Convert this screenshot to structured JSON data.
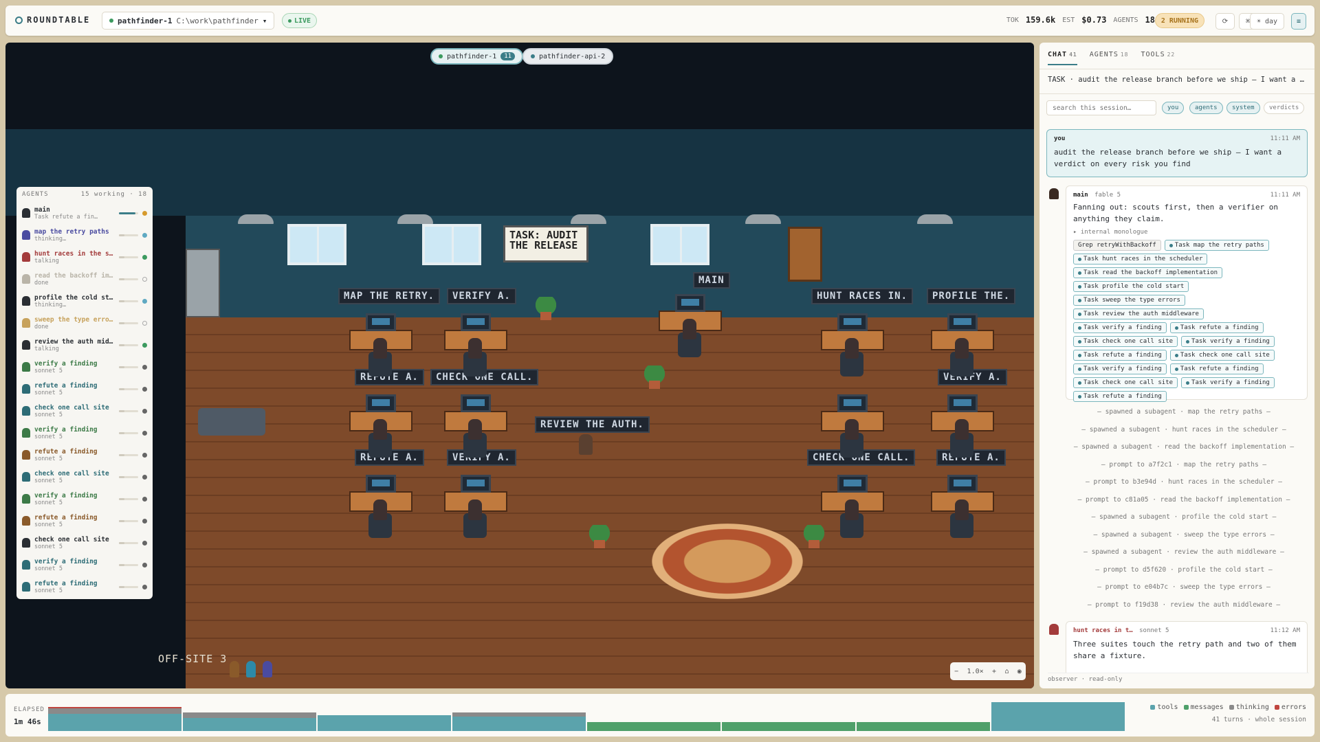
{
  "topbar": {
    "brand": "ROUNDTABLE",
    "repo_name": "pathfinder-1",
    "repo_path": "C:\\work\\pathfinder",
    "repo_caret": "▾",
    "live": "LIVE",
    "tok_label": "TOK",
    "tok_value": "159.6k",
    "est_label": "EST",
    "est_value": "$0.73",
    "agents_label": "AGENTS",
    "agents_value": "18",
    "running": "2 RUNNING",
    "refresh_icon": "⟳",
    "kbd_label": "⌘K",
    "help_label": "?",
    "theme_label": "☀ day",
    "menu_icon": "≡"
  },
  "projects": [
    {
      "label": "pathfinder-1",
      "badge": "11"
    },
    {
      "label": "pathfinder-api-2"
    }
  ],
  "scene": {
    "task_board": "TASK: AUDIT THE RELEASE",
    "room_label": "OFF-SITE 3",
    "signs": [
      "MAP THE RETRY.",
      "VERIFY A.",
      "MAIN",
      "HUNT RACES IN.",
      "PROFILE THE.",
      "REFUTE A.",
      "CHECK ONE CALL.",
      "VERIFY A.",
      "REVIEW THE AUTH.",
      "REFUTE A.",
      "VERIFY A.",
      "CHECK ONE CALL.",
      "REFUTE A."
    ]
  },
  "zoom": {
    "minus": "−",
    "value": "1.0×",
    "plus": "+",
    "home": "⌂",
    "target": "◉"
  },
  "agents_panel": {
    "title": "AGENTS",
    "summary": "15 working · 18",
    "items": [
      {
        "name": "main",
        "sub": "Task refute a fin…",
        "color": "#2a2e33",
        "status": "#d69a2d",
        "progress": 0.85
      },
      {
        "name": "map the retry paths",
        "sub": "thinking…",
        "color": "#4a4ba0",
        "status": "#5fa9c2",
        "progress": 0.3
      },
      {
        "name": "hunt races in the sch…",
        "sub": "talking",
        "color": "#a33b3b",
        "status": "#3c9a5f",
        "progress": 0.3
      },
      {
        "name": "read the backoff impl…",
        "sub": "done",
        "color": "#b9b4a8",
        "status": "none",
        "progress": 0.3
      },
      {
        "name": "profile the cold start",
        "sub": "thinking…",
        "color": "#2a2e33",
        "status": "#5fa9c2",
        "progress": 0.3
      },
      {
        "name": "sweep the type errors",
        "sub": "done",
        "color": "#c7a25c",
        "status": "none",
        "progress": 0.3
      },
      {
        "name": "review the auth middl…",
        "sub": "talking",
        "color": "#2a2e33",
        "status": "#3c9a5f",
        "progress": 0.3
      },
      {
        "name": "verify a finding",
        "sub": "sonnet 5",
        "color": "#3c7a47",
        "status": "#666",
        "progress": 0.3
      },
      {
        "name": "refute a finding",
        "sub": "sonnet 5",
        "color": "#2d6c76",
        "status": "#666",
        "progress": 0.3
      },
      {
        "name": "check one call site",
        "sub": "sonnet 5",
        "color": "#2d6c76",
        "status": "#666",
        "progress": 0.3
      },
      {
        "name": "verify a finding",
        "sub": "sonnet 5",
        "color": "#3c7a47",
        "status": "#666",
        "progress": 0.3
      },
      {
        "name": "refute a finding",
        "sub": "sonnet 5",
        "color": "#8a5a2a",
        "status": "#666",
        "progress": 0.3
      },
      {
        "name": "check one call site",
        "sub": "sonnet 5",
        "color": "#2d6c76",
        "status": "#666",
        "progress": 0.3
      },
      {
        "name": "verify a finding",
        "sub": "sonnet 5",
        "color": "#3c7a47",
        "status": "#666",
        "progress": 0.3
      },
      {
        "name": "refute a finding",
        "sub": "sonnet 5",
        "color": "#8a5a2a",
        "status": "#666",
        "progress": 0.3
      },
      {
        "name": "check one call site",
        "sub": "sonnet 5",
        "color": "#2a2e33",
        "status": "#666",
        "progress": 0.3
      },
      {
        "name": "verify a finding",
        "sub": "sonnet 5",
        "color": "#2d6c76",
        "status": "#666",
        "progress": 0.3
      },
      {
        "name": "refute a finding",
        "sub": "sonnet 5",
        "color": "#2d6c76",
        "status": "#666",
        "progress": 0.3
      }
    ]
  },
  "side": {
    "tabs": [
      {
        "label": "CHAT",
        "count": "41"
      },
      {
        "label": "AGENTS",
        "count": "18"
      },
      {
        "label": "TOOLS",
        "count": "22"
      }
    ],
    "task": "TASK · audit the release branch before we ship — I want a verdict on every risk you find",
    "search_placeholder": "search this session…",
    "filters": [
      "you",
      "agents",
      "system",
      "verdicts"
    ],
    "you_msg": {
      "author": "you",
      "time": "11:11 AM",
      "text": "audit the release branch before we ship — I want a verdict on every risk you find"
    },
    "main_msg": {
      "author": "main",
      "model": "fable 5",
      "time": "11:11 AM",
      "text": "Fanning out: scouts first, then a verifier on anything they claim.",
      "monologue": "▸ internal monologue",
      "chips": [
        "Grep retryWithBackoff",
        "Task map the retry paths",
        "Task hunt races in the scheduler",
        "Task read the backoff implementation",
        "Task profile the cold start",
        "Task sweep the type errors",
        "Task review the auth middleware",
        "Task verify a finding",
        "Task refute a finding",
        "Task check one call site",
        "Task verify a finding",
        "Task refute a finding",
        "Task check one call site",
        "Task verify a finding",
        "Task refute a finding",
        "Task check one call site",
        "Task verify a finding",
        "Task refute a finding"
      ]
    },
    "system_lines": [
      "— spawned a subagent · map the retry paths —",
      "— spawned a subagent · hunt races in the scheduler —",
      "— spawned a subagent · read the backoff implementation —",
      "— prompt to a7f2c1 · map the retry paths —",
      "— prompt to b3e94d · hunt races in the scheduler —",
      "— prompt to c81a05 · read the backoff implementation —",
      "— spawned a subagent · profile the cold start —",
      "— spawned a subagent · sweep the type errors —",
      "— spawned a subagent · review the auth middleware —",
      "— prompt to d5f620 · profile the cold start —",
      "— prompt to e04b7c · sweep the type errors —",
      "— prompt to f19d38 · review the auth middleware —"
    ],
    "hunt_msg": {
      "author": "hunt races in t…",
      "model": "sonnet 5",
      "time": "11:12 AM",
      "text": "Three suites touch the retry path and two of them share a fixture."
    },
    "observer": "observer · read-only"
  },
  "timeline": {
    "label": "ELAPSED",
    "value": "1m 46s",
    "turns": "41 turns · whole session",
    "legend": [
      {
        "label": "tools",
        "color": "#5ba3ac"
      },
      {
        "label": "messages",
        "color": "#4fa06a"
      },
      {
        "label": "thinking",
        "color": "#8a8a8a"
      },
      {
        "label": "errors",
        "color": "#c0463f"
      }
    ],
    "colors": {
      "tools": "#5ba3ac",
      "messages": "#4fa06a",
      "thinking": "#8a8a8a",
      "errors": "#c0463f"
    },
    "turns_data": [
      {
        "tools": 0.6,
        "thinking": 0.2,
        "messages": 0,
        "errors": 0.05
      },
      {
        "tools": 0.45,
        "thinking": 0.2,
        "messages": 0,
        "errors": 0
      },
      {
        "tools": 0.55,
        "thinking": 0,
        "messages": 0,
        "errors": 0
      },
      {
        "tools": 0.5,
        "thinking": 0.15,
        "messages": 0,
        "errors": 0
      },
      {
        "tools": 0,
        "thinking": 0,
        "messages": 0.3,
        "errors": 0
      },
      {
        "tools": 0,
        "thinking": 0,
        "messages": 0.3,
        "errors": 0
      },
      {
        "tools": 0,
        "thinking": 0,
        "messages": 0.3,
        "errors": 0
      },
      {
        "tools": 1.0,
        "thinking": 0,
        "messages": 0,
        "errors": 0
      }
    ]
  }
}
